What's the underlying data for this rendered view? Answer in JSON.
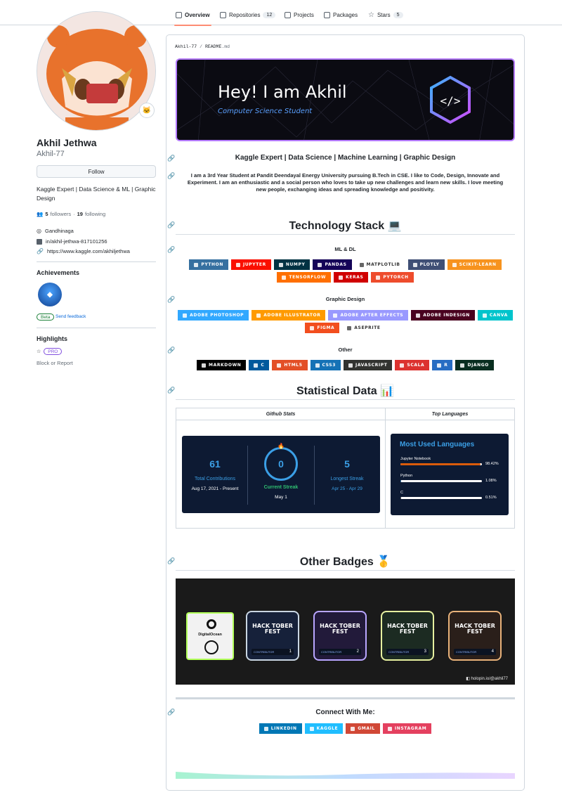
{
  "tabs": [
    {
      "label": "Overview",
      "count": ""
    },
    {
      "label": "Repositories",
      "count": "12"
    },
    {
      "label": "Projects",
      "count": ""
    },
    {
      "label": "Packages",
      "count": ""
    },
    {
      "label": "Stars",
      "count": "5"
    }
  ],
  "profile": {
    "name": "Akhil Jethwa",
    "login": "Akhil-77",
    "follow_label": "Follow",
    "bio": "Kaggle Expert | Data Science & ML | Graphic Design",
    "followers_count": "5",
    "followers_label": "followers",
    "following_count": "19",
    "following_label": "following",
    "location": "Gandhinaga",
    "linkedin": "in/akhil-jethwa-817101256",
    "website": "https://www.kaggle.com/akhiljethwa",
    "achievements_title": "Achievements",
    "beta_label": "Beta",
    "feedback_label": "Send feedback",
    "highlights_title": "Highlights",
    "pro_label": "PRO",
    "block_label": "Block or Report"
  },
  "readme": {
    "path_user": "Akhil-77",
    "path_sep": "/",
    "path_file": "README",
    "path_ext": ".md",
    "banner_title": "Hey! I am Akhil",
    "banner_subtitle": "Computer Science Student",
    "tagline": "Kaggle Expert | Data Science | Machine Learning | Graphic Design",
    "intro": "I am a 3rd Year Student at Pandit Deendayal Energy University pursuing B.Tech in CSE. I like to Code, Design, Innovate and Experiment. I am an enthusiastic and a social person who loves to take up new challenges and learn new skills. I love meeting new people, exchanging ideas and spreading knowledge and positivity.",
    "tech_title": "Technology Stack 💻",
    "ml_title": "ML & DL",
    "ml_badges": [
      {
        "label": "PYTHON",
        "color": "#3670A0"
      },
      {
        "label": "JUPYTER",
        "color": "#FA0F00"
      },
      {
        "label": "NUMPY",
        "color": "#013243"
      },
      {
        "label": "PANDAS",
        "color": "#150458"
      },
      {
        "label": "MATPLOTLIB",
        "color": "#ffffff"
      },
      {
        "label": "PLOTLY",
        "color": "#3F4F75"
      },
      {
        "label": "SCIKIT-LEARN",
        "color": "#F7931E"
      },
      {
        "label": "TENSORFLOW",
        "color": "#FF6F00"
      },
      {
        "label": "KERAS",
        "color": "#D00000"
      },
      {
        "label": "PYTORCH",
        "color": "#EE4C2C"
      }
    ],
    "design_title": "Graphic Design",
    "design_badges": [
      {
        "label": "ADOBE PHOTOSHOP",
        "color": "#31A8FF"
      },
      {
        "label": "ADOBE ILLUSTRATOR",
        "color": "#FF9A00"
      },
      {
        "label": "ADOBE AFTER EFFECTS",
        "color": "#9999FF"
      },
      {
        "label": "ADOBE INDESIGN",
        "color": "#49021F"
      },
      {
        "label": "CANVA",
        "color": "#00C4CC"
      },
      {
        "label": "FIGMA",
        "color": "#F24E1E"
      },
      {
        "label": "ASEPRITE",
        "color": "#ffffff"
      }
    ],
    "other_title": "Other",
    "other_badges": [
      {
        "label": "MARKDOWN",
        "color": "#000000"
      },
      {
        "label": "C",
        "color": "#00599C"
      },
      {
        "label": "HTML5",
        "color": "#E34F26"
      },
      {
        "label": "CSS3",
        "color": "#1572B6"
      },
      {
        "label": "JAVASCRIPT",
        "color": "#323330"
      },
      {
        "label": "SCALA",
        "color": "#DC322F"
      },
      {
        "label": "R",
        "color": "#276DC3"
      },
      {
        "label": "DJANGO",
        "color": "#092E20"
      }
    ],
    "stats_title": "Statistical Data 📊",
    "github_stats_header": "Github Stats",
    "top_lang_header": "Top Languages",
    "total_contrib_value": "61",
    "total_contrib_label": "Total Contributions",
    "total_contrib_range": "Aug 17, 2021 - Present",
    "current_streak_value": "0",
    "current_streak_label": "Current Streak",
    "current_streak_date": "May 1",
    "longest_streak_value": "5",
    "longest_streak_label": "Longest Streak",
    "longest_streak_range": "Apr 25 - Apr 29",
    "langs_title": "Most Used Languages",
    "languages": [
      {
        "name": "Jupyter Notebook",
        "pct": "98.42%",
        "value": 98.42,
        "color": "#DA5B0B"
      },
      {
        "name": "Python",
        "pct": "1.08%",
        "value": 1.08,
        "color": "#3572A5"
      },
      {
        "name": "C",
        "pct": "0.51%",
        "value": 0.51,
        "color": "#555555"
      }
    ],
    "badges_title": "Other Badges 🥇",
    "do_label": "DigitalOcean",
    "hack_label": "HACK TOBER FEST",
    "contributor_label": "CONTRIBUTOR",
    "hack_levels": [
      "1",
      "2",
      "3",
      "4"
    ],
    "holopin_tag": "holopin.io/@akhil77",
    "connect_title": "Connect With Me:",
    "connect_badges": [
      {
        "label": "LINKEDIN",
        "color": "#0077B5"
      },
      {
        "label": "KAGGLE",
        "color": "#20BEFF"
      },
      {
        "label": "GMAIL",
        "color": "#D14836"
      },
      {
        "label": "INSTAGRAM",
        "color": "#E4405F"
      }
    ]
  }
}
